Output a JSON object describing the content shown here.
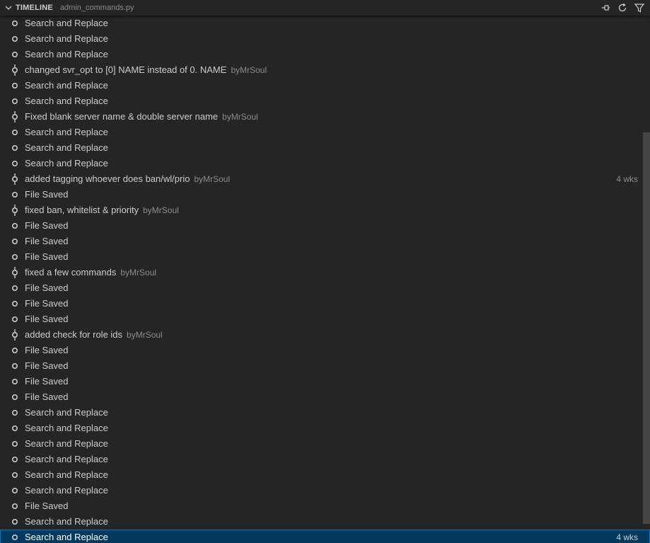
{
  "header": {
    "title": "TIMELINE",
    "file": "admin_commands.py",
    "actions": [
      {
        "name": "pin-icon"
      },
      {
        "name": "refresh-icon"
      },
      {
        "name": "filter-icon"
      }
    ]
  },
  "rows": [
    {
      "label": "Search and Replace",
      "kind": "local"
    },
    {
      "label": "Search and Replace",
      "kind": "local"
    },
    {
      "label": "Search and Replace",
      "kind": "local"
    },
    {
      "label": "changed svr_opt to [0] NAME instead of 0. NAME",
      "author": "byMrSoul",
      "kind": "commit"
    },
    {
      "label": "Search and Replace",
      "kind": "local"
    },
    {
      "label": "Search and Replace",
      "kind": "local"
    },
    {
      "label": "Fixed blank server name & double server name",
      "author": "byMrSoul",
      "kind": "commit"
    },
    {
      "label": "Search and Replace",
      "kind": "local"
    },
    {
      "label": "Search and Replace",
      "kind": "local"
    },
    {
      "label": "Search and Replace",
      "kind": "local"
    },
    {
      "label": "added tagging whoever does ban/wl/prio",
      "author": "byMrSoul",
      "time": "4 wks",
      "kind": "commit"
    },
    {
      "label": "File Saved",
      "kind": "local"
    },
    {
      "label": "fixed ban, whitelist & priority",
      "author": "byMrSoul",
      "kind": "commit"
    },
    {
      "label": "File Saved",
      "kind": "local"
    },
    {
      "label": "File Saved",
      "kind": "local"
    },
    {
      "label": "File Saved",
      "kind": "local"
    },
    {
      "label": "fixed a few commands",
      "author": "byMrSoul",
      "kind": "commit"
    },
    {
      "label": "File Saved",
      "kind": "local"
    },
    {
      "label": "File Saved",
      "kind": "local"
    },
    {
      "label": "File Saved",
      "kind": "local"
    },
    {
      "label": "added check for role ids",
      "author": "byMrSoul",
      "kind": "commit"
    },
    {
      "label": "File Saved",
      "kind": "local"
    },
    {
      "label": "File Saved",
      "kind": "local"
    },
    {
      "label": "File Saved",
      "kind": "local"
    },
    {
      "label": "File Saved",
      "kind": "local"
    },
    {
      "label": "Search and Replace",
      "kind": "local"
    },
    {
      "label": "Search and Replace",
      "kind": "local"
    },
    {
      "label": "Search and Replace",
      "kind": "local"
    },
    {
      "label": "Search and Replace",
      "kind": "local"
    },
    {
      "label": "Search and Replace",
      "kind": "local"
    },
    {
      "label": "Search and Replace",
      "kind": "local"
    },
    {
      "label": "File Saved",
      "kind": "local"
    },
    {
      "label": "Search and Replace",
      "kind": "local"
    },
    {
      "label": "Search and Replace",
      "time": "4 wks",
      "kind": "local",
      "selected": true
    }
  ],
  "colors": {
    "background": "#252526",
    "selected": "#04395e",
    "selected_border": "#0a74c7"
  }
}
